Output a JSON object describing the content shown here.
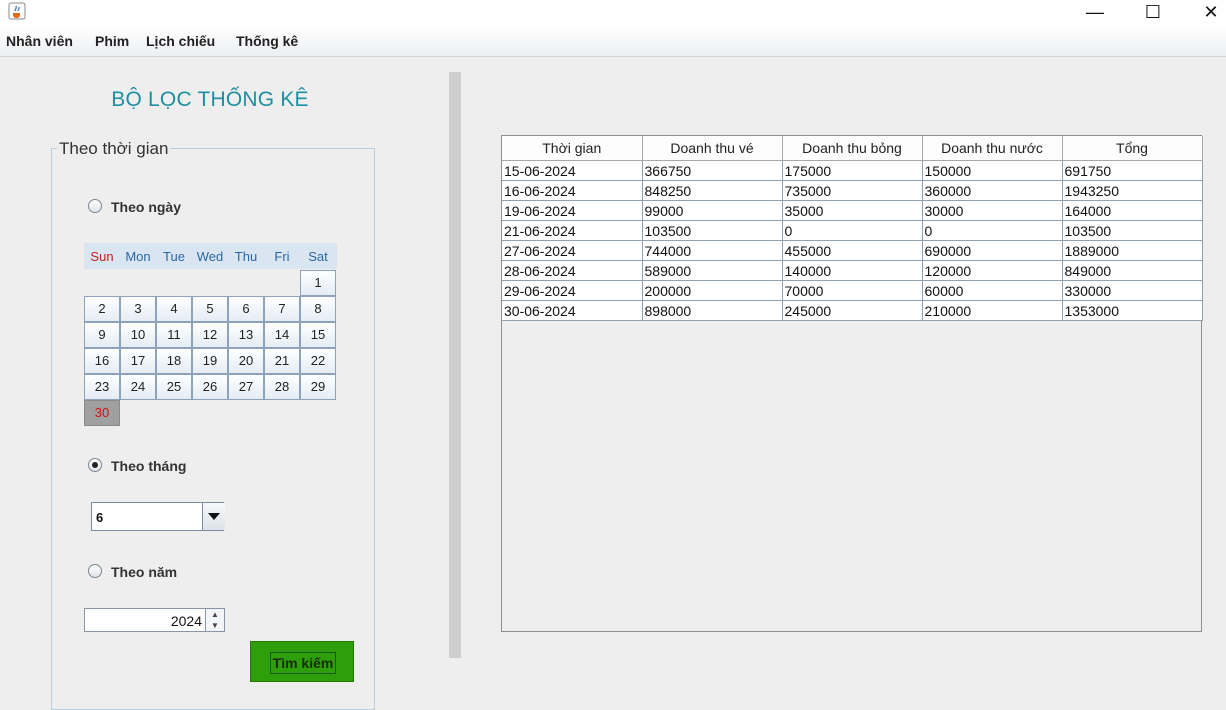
{
  "window": {
    "minimize_glyph": "—",
    "maximize_glyph": "☐",
    "close_glyph": "✕"
  },
  "menu": {
    "items": [
      {
        "label": "Nhân viên"
      },
      {
        "label": "Phim"
      },
      {
        "label": "Lịch chiếu"
      },
      {
        "label": "Thống kê"
      }
    ]
  },
  "filter": {
    "title": "BỘ LỌC THỐNG KÊ",
    "group_title": "Theo thời gian",
    "by_day_label": "Theo ngày",
    "by_month_label": "Theo tháng",
    "by_year_label": "Theo năm",
    "selected_mode": "month",
    "calendar": {
      "days_of_week": [
        "Sun",
        "Mon",
        "Tue",
        "Wed",
        "Thu",
        "Fri",
        "Sat"
      ],
      "first_weekday_index": 6,
      "day_count": 30,
      "selected_day": 30,
      "day_labels": [
        "1",
        "2",
        "3",
        "4",
        "5",
        "6",
        "7",
        "8",
        "9",
        "10",
        "11",
        "12",
        "13",
        "14",
        "15",
        "16",
        "17",
        "18",
        "19",
        "20",
        "21",
        "22",
        "23",
        "24",
        "25",
        "26",
        "27",
        "28",
        "29",
        "30"
      ]
    },
    "month_value": "6",
    "year_value": "2024",
    "search_button": "Tìm kiếm"
  },
  "table": {
    "columns": [
      "Thời gian",
      "Doanh thu vé",
      "Doanh thu bỏng",
      "Doanh thu nước",
      "Tổng"
    ],
    "rows": [
      [
        "15-06-2024",
        "366750",
        "175000",
        "150000",
        "691750"
      ],
      [
        "16-06-2024",
        "848250",
        "735000",
        "360000",
        "1943250"
      ],
      [
        "19-06-2024",
        "99000",
        "35000",
        "30000",
        "164000"
      ],
      [
        "21-06-2024",
        "103500",
        "0",
        "0",
        "103500"
      ],
      [
        "27-06-2024",
        "744000",
        "455000",
        "690000",
        "1889000"
      ],
      [
        "28-06-2024",
        "589000",
        "140000",
        "120000",
        "849000"
      ],
      [
        "29-06-2024",
        "200000",
        "70000",
        "60000",
        "330000"
      ],
      [
        "30-06-2024",
        "898000",
        "245000",
        "210000",
        "1353000"
      ]
    ]
  },
  "colors": {
    "title_accent": "#1e8fa0",
    "button_green": "#2e9e0a",
    "selected_day_bg": "#a0a0a0",
    "sunday_red": "#c02020"
  }
}
